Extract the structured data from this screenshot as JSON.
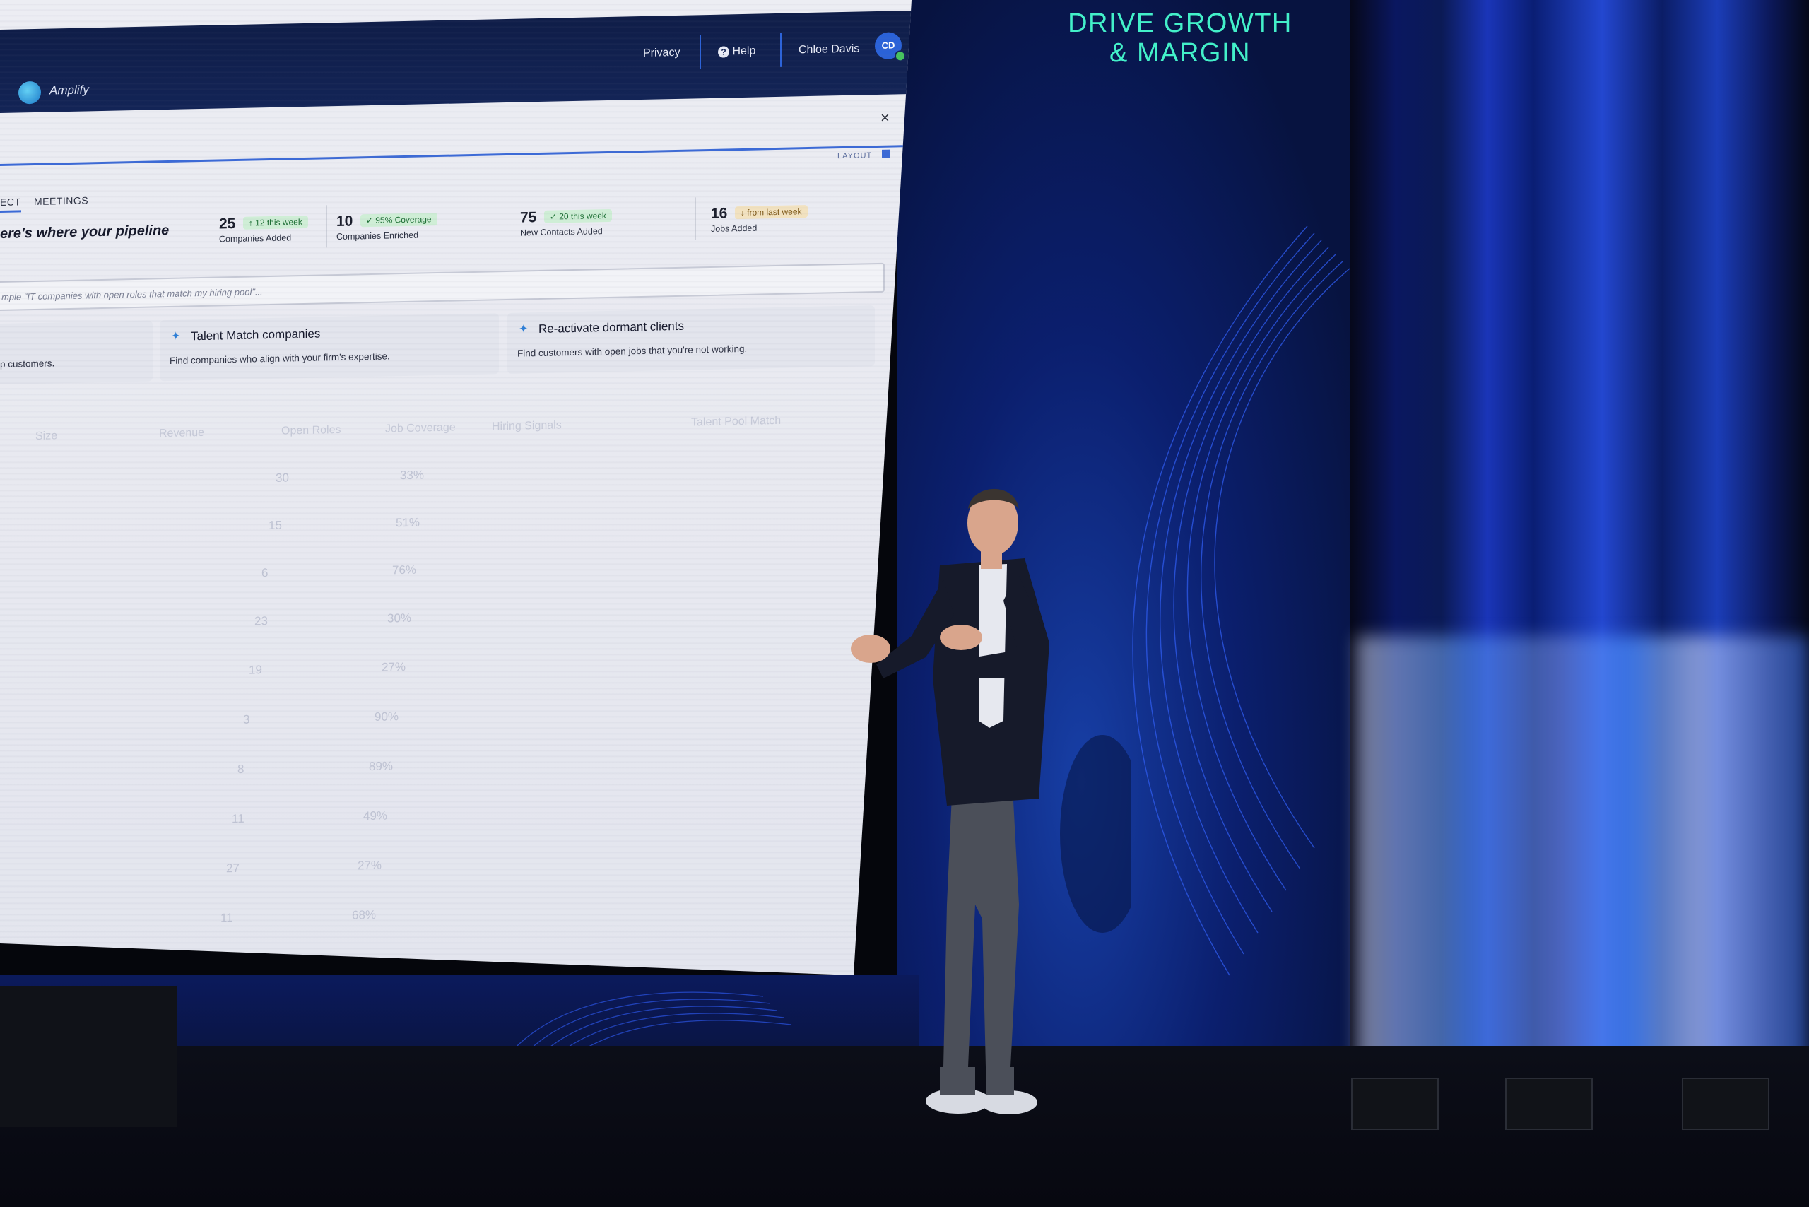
{
  "slide": {
    "headline_line1": "DRIVE GROWTH",
    "headline_line2": "& MARGIN"
  },
  "app": {
    "name": "Amplify",
    "topbar": {
      "privacy": "Privacy",
      "help": "Help",
      "user_name": "Chloe Davis",
      "user_initials": "CD"
    },
    "close": "×",
    "layout_label": "LAYOUT",
    "tabs": [
      "ECT",
      "MEETINGS"
    ],
    "heading": "ere's where your pipeline",
    "stats": [
      {
        "value": "25",
        "badge": "12 this week",
        "label": "Companies Added",
        "tone": "green",
        "arrow": "↑"
      },
      {
        "value": "10",
        "badge": "95% Coverage",
        "label": "Companies Enriched",
        "tone": "green",
        "arrow": "✓"
      },
      {
        "value": "75",
        "badge": "20 this week",
        "label": "New Contacts Added",
        "tone": "green",
        "arrow": "✓"
      },
      {
        "value": "16",
        "badge": "from last week",
        "label": "Jobs Added",
        "tone": "amber",
        "arrow": "↓"
      }
    ],
    "search_placeholder": "mple \"IT companies with open roles that match my hiring pool\"...",
    "suggestions": [
      {
        "title": "",
        "desc": "p customers."
      },
      {
        "title": "Talent Match companies",
        "desc": "Find companies who align with your firm's expertise."
      },
      {
        "title": "Re-activate dormant clients",
        "desc": "Find customers with open jobs that you're not working."
      }
    ],
    "table_headers": [
      "Size",
      "Revenue",
      "Open Roles",
      "Job Coverage",
      "Hiring Signals",
      "Talent Pool Match"
    ],
    "table_rows": [
      {
        "roles": "30",
        "coverage": "33%"
      },
      {
        "roles": "15",
        "coverage": "51%"
      },
      {
        "roles": "6",
        "coverage": "76%"
      },
      {
        "roles": "23",
        "coverage": "30%"
      },
      {
        "roles": "19",
        "coverage": "27%"
      },
      {
        "roles": "3",
        "coverage": "90%"
      },
      {
        "roles": "8",
        "coverage": "89%"
      },
      {
        "roles": "11",
        "coverage": "49%"
      },
      {
        "roles": "27",
        "coverage": "27%"
      },
      {
        "roles": "11",
        "coverage": "68%"
      }
    ]
  },
  "colors": {
    "headline": "#43f0c9",
    "topbar": "#0f1d48",
    "accent": "#3c6ad6",
    "curtain": "#1a35b8"
  }
}
